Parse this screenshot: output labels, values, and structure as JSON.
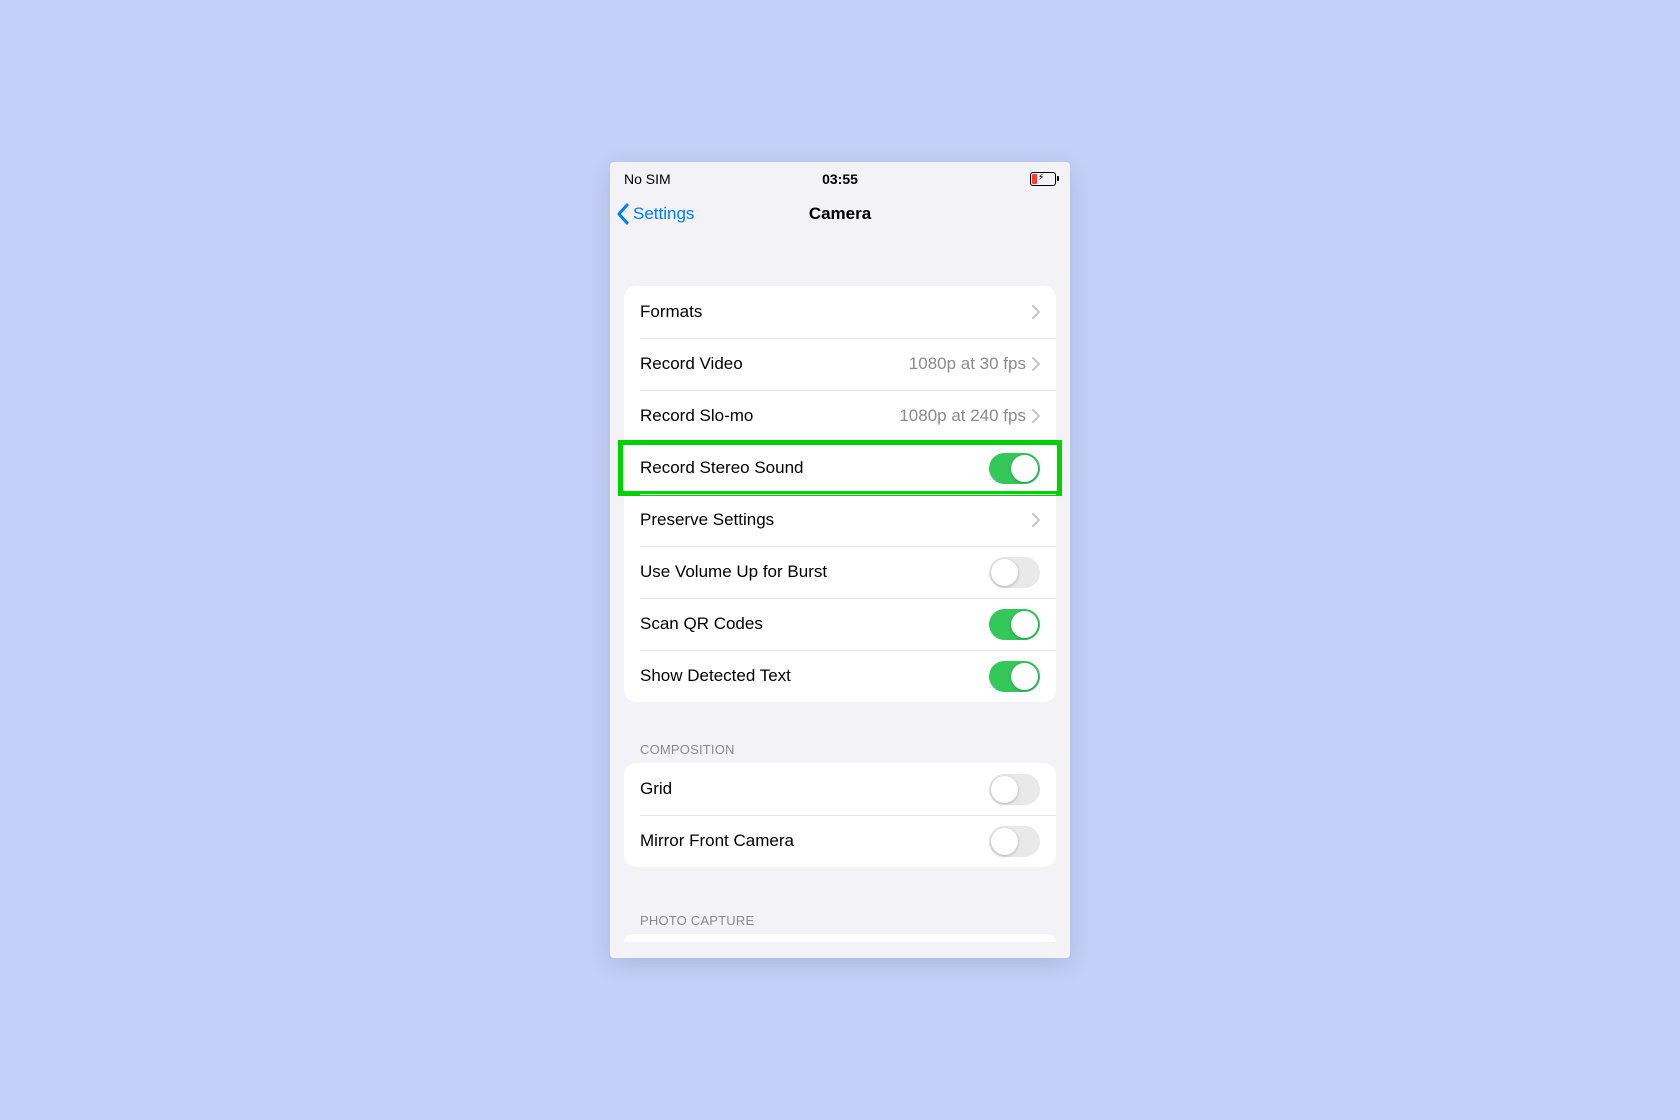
{
  "statusbar": {
    "carrier": "No SIM",
    "time": "03:55"
  },
  "nav": {
    "back": "Settings",
    "title": "Camera"
  },
  "group1": {
    "items": [
      {
        "label": "Formats",
        "type": "link"
      },
      {
        "label": "Record Video",
        "detail": "1080p at 30 fps",
        "type": "link"
      },
      {
        "label": "Record Slo-mo",
        "detail": "1080p at 240 fps",
        "type": "link"
      },
      {
        "label": "Record Stereo Sound",
        "type": "toggle",
        "on": true,
        "highlight": true
      },
      {
        "label": "Preserve Settings",
        "type": "link"
      },
      {
        "label": "Use Volume Up for Burst",
        "type": "toggle",
        "on": false
      },
      {
        "label": "Scan QR Codes",
        "type": "toggle",
        "on": true
      },
      {
        "label": "Show Detected Text",
        "type": "toggle",
        "on": true
      }
    ]
  },
  "group2": {
    "header": "COMPOSITION",
    "items": [
      {
        "label": "Grid",
        "type": "toggle",
        "on": false
      },
      {
        "label": "Mirror Front Camera",
        "type": "toggle",
        "on": false
      }
    ]
  },
  "group3": {
    "header": "PHOTO CAPTURE"
  }
}
